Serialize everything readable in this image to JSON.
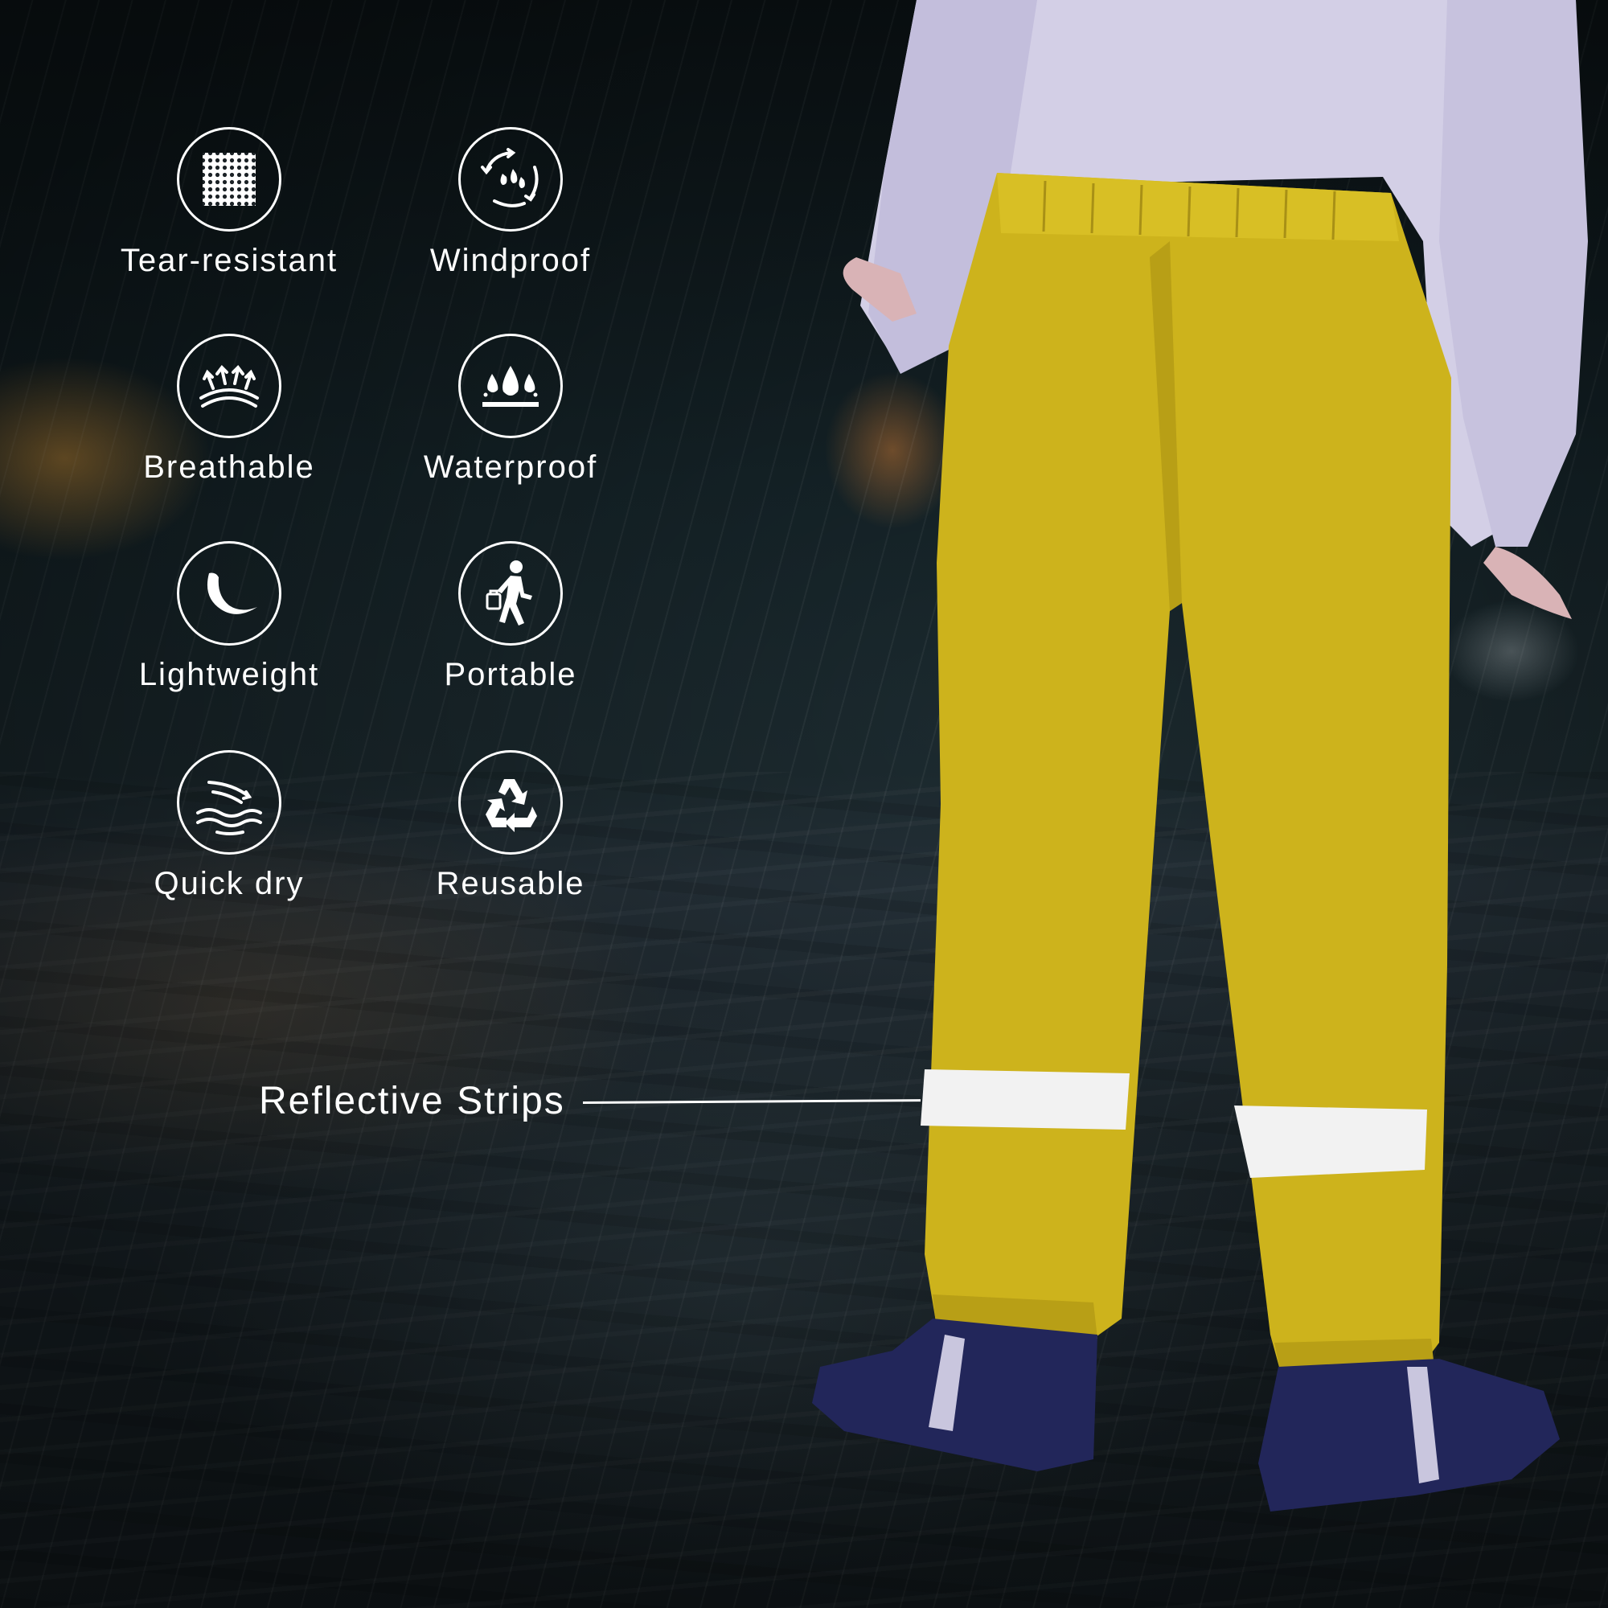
{
  "features": [
    {
      "label": "Tear-resistant",
      "icon": "mesh-grid-icon"
    },
    {
      "label": "Windproof",
      "icon": "wind-cycle-icon"
    },
    {
      "label": "Breathable",
      "icon": "breathable-arrows-icon"
    },
    {
      "label": "Waterproof",
      "icon": "water-drops-icon"
    },
    {
      "label": "Lightweight",
      "icon": "feather-icon"
    },
    {
      "label": "Portable",
      "icon": "walking-person-icon"
    },
    {
      "label": "Quick dry",
      "icon": "wind-waves-icon"
    },
    {
      "label": "Reusable",
      "icon": "recycle-icon"
    }
  ],
  "callout": {
    "label": "Reflective Strips"
  },
  "colors": {
    "pants": "#cdb31c",
    "shirt": "#d3cfe6",
    "boots": "#22265a",
    "reflective": "#f2f2f2",
    "text": "#ffffff"
  }
}
